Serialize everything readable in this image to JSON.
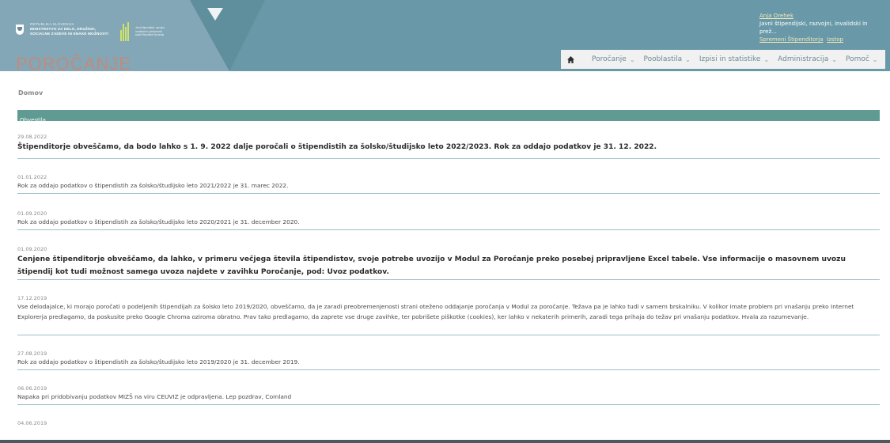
{
  "header": {
    "ministry_lines": [
      "REPUBLIKA SLOVENIJA",
      "MINISTRSTVO ZA DELO, DRUŽINO,",
      "SOCIALNE ZADEVE IN ENAKE MOŽNOSTI"
    ],
    "fund_lines": [
      "Javni štipendijski, razvojni,",
      "invalidski in preživninski",
      "sklad Republike Slovenije"
    ],
    "brand_title": "POROČANJE"
  },
  "user": {
    "name": "Anja Orehek",
    "organization": "Javni štipendijski, razvojni, invalidski in prež...",
    "change_link": "Spremeni Štipenditorja",
    "logout_link": "Izstop"
  },
  "menu": [
    {
      "label": "Poročanje"
    },
    {
      "label": "Pooblastila"
    },
    {
      "label": "Izpisi in statistike"
    },
    {
      "label": "Administracija"
    },
    {
      "label": "Pomoč"
    }
  ],
  "breadcrumb": "Domov",
  "section_title": "Obvestila",
  "notices": [
    {
      "date": "29.08.2022",
      "text": "Štipenditorje obveščamo, da bodo lahko s 1. 9. 2022 dalje poročali o štipendistih za šolsko/študijsko leto 2022/2023. Rok za oddajo podatkov je 31. 12. 2022.",
      "bold": true
    },
    {
      "date": "01.01.2022",
      "text": "Rok za oddajo podatkov o štipendistih za šolsko/študijsko leto 2021/2022 je 31. marec 2022.",
      "bold": false
    },
    {
      "date": "01.09.2020",
      "text": "Rok za oddajo podatkov o štipendistih za šolsko/študijsko leto 2020/2021 je 31. december 2020.",
      "bold": false
    },
    {
      "date": "01.09.2020",
      "text": "Cenjene štipenditorje obveščamo, da lahko, v primeru večjega števila štipendistov, svoje potrebe uvozijo v Modul za Poročanje preko posebej pripravljene Excel tabele. Vse informacije o masovnem uvozu štipendij kot tudi možnost samega uvoza najdete v zavihku Poročanje, pod: Uvoz podatkov.",
      "bold": true
    },
    {
      "date": "17.12.2019",
      "text": "Vse delodajalce, ki morajo poročati o podeljenih štipendijah za šolsko leto 2019/2020, obveščamo, da je zaradi preobremenjenosti strani oteženo oddajanje poročanja v Modul za poročanje. Težava pa je lahko tudi v samem brskalniku. V kolikor imate problem pri vnašanju preko Internet Explorerja predlagamo, da poskusite preko Google Chroma oziroma obratno. Prav tako predlagamo, da zaprete vse druge zavihke, ter pobrišete piškotke (cookies), ker lahko v nekaterih primerih, zaradi tega prihaja do težav pri vnašanju podatkov. Hvala za razumevanje.",
      "bold": false
    },
    {
      "date": "27.08.2019",
      "text": "Rok za oddajo podatkov o štipendistih za šolsko/študijsko leto 2019/2020 je 31. december 2019.",
      "bold": false
    },
    {
      "date": "06.06.2019",
      "text": "Napaka pri pridobivanju podatkov MIZŠ na viru CEUVIZ je odpravljena. Lep pozdrav, Comland",
      "bold": false
    },
    {
      "date": "04.06.2019",
      "text": "",
      "bold": false
    }
  ],
  "colors": {
    "header_bg": "#6999a8",
    "menu_bg": "#f1f1f1",
    "section_bar": "#5f9b92",
    "separator": "#9ec0c6",
    "link": "#f2e7b8"
  }
}
